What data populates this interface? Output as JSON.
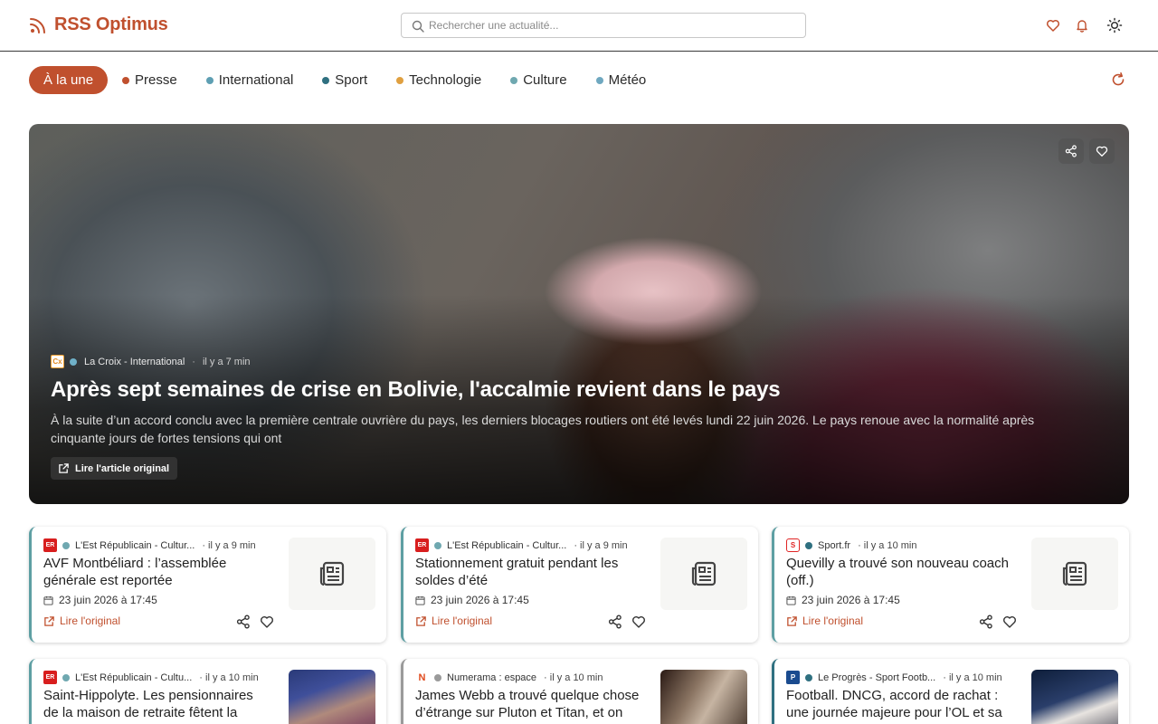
{
  "app": {
    "name": "RSS Optimus",
    "brand_color": "#c0502e"
  },
  "header": {
    "search_placeholder": "Rechercher une actualité...",
    "icons": [
      "heart-icon",
      "bell-icon",
      "sun-icon"
    ]
  },
  "nav": {
    "items": [
      {
        "label": "À la une",
        "active": true
      },
      {
        "label": "Presse",
        "dot_color": "#c0502e"
      },
      {
        "label": "International",
        "dot_color": "#5e9fb3"
      },
      {
        "label": "Sport",
        "dot_color": "#2f7080"
      },
      {
        "label": "Technologie",
        "dot_color": "#e0a040"
      },
      {
        "label": "Culture",
        "dot_color": "#6fa8b0"
      },
      {
        "label": "Météo",
        "dot_color": "#6fa8c0"
      }
    ]
  },
  "hero": {
    "source": "La Croix - International",
    "source_logo": "Cx",
    "time_ago": "il y a 7 min",
    "title": "Après sept semaines de crise en Bolivie, l'accalmie revient dans le pays",
    "description": "À la suite d’un accord conclu avec la première centrale ouvrière du pays, les derniers blocages routiers ont été levés lundi 22 juin 2026. Le pays renoue avec la normalité après cinquante jours de fortes tensions qui ont",
    "read_label": "Lire l'article original"
  },
  "cards": [
    {
      "source": "L'Est Républicain - Cultur...",
      "logo": "ER",
      "time_ago": "· il y a 9 min",
      "title": "AVF Montbéliard : l’assemblée générale est reportée",
      "date": "23 juin 2026 à 17:45",
      "read_label": "Lire l'original"
    },
    {
      "source": "L'Est Républicain - Cultur...",
      "logo": "ER",
      "time_ago": "· il y a 9 min",
      "title": "Stationnement gratuit pendant les soldes d’été",
      "date": "23 juin 2026 à 17:45",
      "read_label": "Lire l'original"
    },
    {
      "source": "Sport.fr",
      "logo": "S",
      "time_ago": "· il y a 10 min",
      "title": "Quevilly a trouvé son nouveau coach (off.)",
      "date": "23 juin 2026 à 17:45",
      "read_label": "Lire l'original"
    },
    {
      "source": "L'Est Républicain - Cultu...",
      "logo": "ER",
      "time_ago": "· il y a 10 min",
      "title": "Saint-Hippolyte. Les pensionnaires de la maison de retraite fêtent la musique",
      "date": "",
      "read_label": ""
    },
    {
      "source": "Numerama : espace",
      "logo": "N",
      "time_ago": "· il y a 10 min",
      "title": "James Webb a trouvé quelque chose d’étrange sur Pluton et Titan, et on ne",
      "date": "",
      "read_label": ""
    },
    {
      "source": "Le Progrès - Sport Footb...",
      "logo": "P",
      "time_ago": "· il y a 10 min",
      "title": "Football. DNCG, accord de rachat : une journée majeure pour l’OL et sa",
      "date": "",
      "read_label": ""
    }
  ],
  "colors": {
    "card_accent": "#5e9fa3",
    "link": "#c0502e"
  }
}
